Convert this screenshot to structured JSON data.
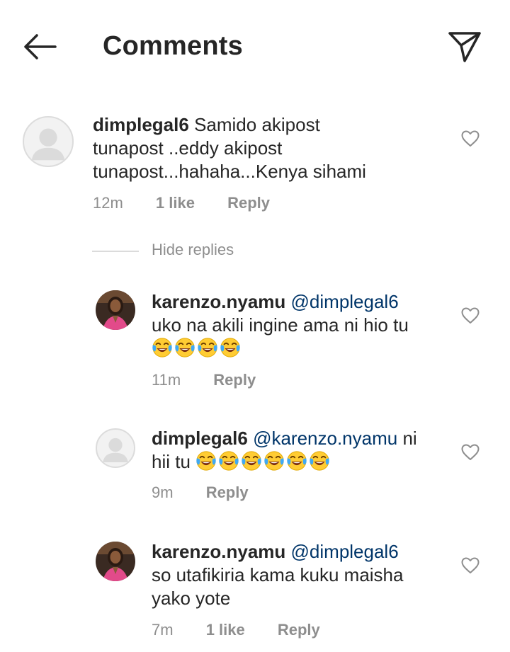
{
  "header": {
    "title": "Comments",
    "back_icon": "arrow-left-icon",
    "share_icon": "paper-plane-icon"
  },
  "colors": {
    "text": "#262626",
    "secondary": "#8e8e8e",
    "mention": "#003569",
    "divider": "#dbdbdb"
  },
  "comments": [
    {
      "username": "dimplegal6",
      "text_lines": [
        "Samido akipost",
        "tunapost ..eddy akipost",
        "tunapost...hahaha...Kenya sihami"
      ],
      "time": "12m",
      "likes": "1 like",
      "reply": "Reply"
    }
  ],
  "hide_replies": "Hide replies",
  "replies": [
    {
      "username": "karenzo.nyamu",
      "mention": "@dimplegal6",
      "text_lines": [
        "uko na akili ingine ama ni hio tu"
      ],
      "emoji_count": 4,
      "emoji_name": "face-with-tears-of-joy",
      "time": "11m",
      "reply": "Reply"
    },
    {
      "username": "dimplegal6",
      "mention": "@karenzo.nyamu",
      "inline_tail": "ni",
      "text_lines": [
        "hii tu"
      ],
      "emoji_count": 6,
      "emoji_name": "face-with-tears-of-joy",
      "time": "9m",
      "reply": "Reply"
    },
    {
      "username": "karenzo.nyamu",
      "mention": "@dimplegal6",
      "text_lines": [
        "so utafikiria kama kuku maisha",
        "yako yote"
      ],
      "time": "7m",
      "likes": "1 like",
      "reply": "Reply"
    }
  ]
}
